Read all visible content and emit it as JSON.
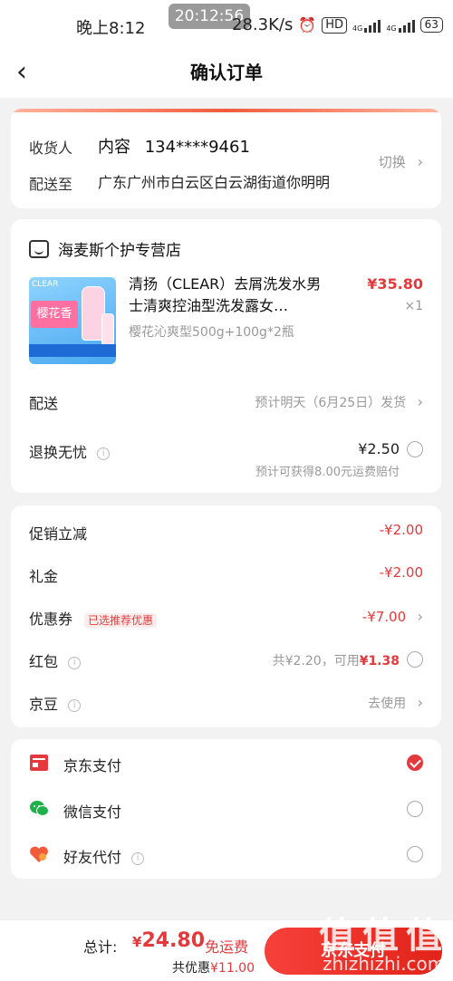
{
  "status_bar": {
    "time": "晚上8:12",
    "clock_overlay": "20:12:56",
    "speed": "28.3K/s",
    "hd_label": "HD",
    "net_label_1": "4G",
    "net_label_2": "4G",
    "battery": "63"
  },
  "header": {
    "back_icon": "‹",
    "title": "确认订单"
  },
  "address": {
    "receiver_label": "收货人",
    "receiver_name": "内容",
    "phone": "134****9461",
    "deliver_label": "配送至",
    "address_text": "广东广州市白云区白云湖街道你明明",
    "switch_label": "切换",
    "chevron": "›"
  },
  "shop": {
    "name": "海麦斯个护专营店",
    "product": {
      "title": "清扬（CLEAR）去屑洗发水男士清爽控油型洗发露女…",
      "price": "¥35.80",
      "qty": "×1",
      "spec": "樱花沁爽型500g+100g*2瓶",
      "image_brand": "CLEAR",
      "image_text": "樱花香"
    },
    "delivery_label": "配送",
    "delivery_value": "预计明天（6月25日）发货",
    "return_label": "退换无忧",
    "return_price": "¥2.50",
    "return_note": "预计可获得8.00元运费赔付",
    "chevron": "›",
    "info_icon": "i"
  },
  "promotions": {
    "items": [
      {
        "label": "促销立减",
        "value": "-¥2.00"
      },
      {
        "label": "礼金",
        "value": "-¥2.00"
      },
      {
        "label": "优惠券",
        "tag": "已选推荐优惠",
        "value": "-¥7.00"
      },
      {
        "label": "红包",
        "value_prefix": "共¥2.20，可用",
        "value_highlight": "¥1.38"
      },
      {
        "label": "京豆",
        "value": "去使用"
      }
    ],
    "chevron": "›",
    "info_icon": "i"
  },
  "payment": {
    "methods": [
      {
        "label": "京东支付",
        "icon": "jd-pay-icon",
        "checked": true
      },
      {
        "label": "微信支付",
        "icon": "wechat-icon",
        "checked": false
      },
      {
        "label": "好友代付",
        "icon": "friend-pay-icon",
        "checked": false
      }
    ],
    "info_icon": "i"
  },
  "footer": {
    "total_label": "总计:",
    "currency": "¥",
    "total_amount": "24.80",
    "free_shipping": "免运费",
    "saving_label": "共优惠",
    "saving_amount": "¥11.00",
    "pay_button": "京东支付"
  },
  "watermark": {
    "glyphs": [
      "值",
      "值",
      "值"
    ],
    "url": "zhizhizhi.com"
  },
  "colors": {
    "accent": "#e4393c",
    "button_start": "#f6413a",
    "button_end": "#e2231a",
    "wechat": "#21b14b"
  }
}
